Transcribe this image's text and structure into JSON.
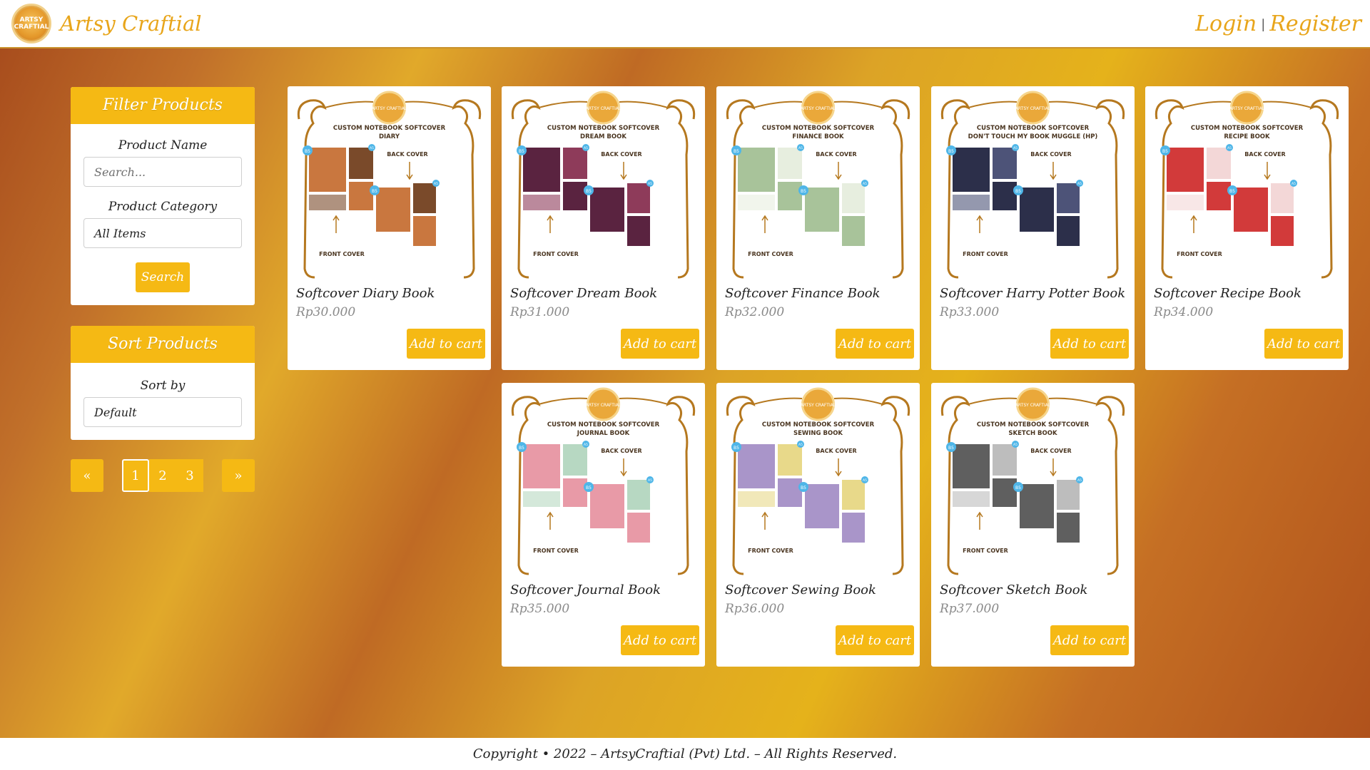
{
  "header": {
    "brand_name": "Artsy Craftial",
    "logo_text": "ARTSY CRAFTIAL",
    "login": "Login",
    "separator": "|",
    "register": "Register"
  },
  "filter": {
    "title": "Filter Products",
    "product_name_label": "Product Name",
    "search_placeholder": "Search...",
    "category_label": "Product Category",
    "category_value": "All Items",
    "search_button": "Search"
  },
  "sort": {
    "title": "Sort Products",
    "sort_by_label": "Sort by",
    "sort_value": "Default"
  },
  "pagination": {
    "prev": "«",
    "pages": [
      "1",
      "2",
      "3"
    ],
    "active_page": "1",
    "next": "»"
  },
  "cover_labels": {
    "back_cover": "BACK COVER",
    "front_cover": "FRONT COVER",
    "b5": "B5",
    "a5": "A5"
  },
  "products": [
    {
      "name": "Softcover Diary Book",
      "price": "Rp30.000",
      "cover_title": "CUSTOM NOTEBOOK SOFTCOVER",
      "cover_subtitle": "DIARY",
      "theme": "#c9773f",
      "theme2": "#7a4a2a"
    },
    {
      "name": "Softcover Dream Book",
      "price": "Rp31.000",
      "cover_title": "CUSTOM NOTEBOOK SOFTCOVER",
      "cover_subtitle": "DREAM BOOK",
      "theme": "#5a2340",
      "theme2": "#8e3b5a"
    },
    {
      "name": "Softcover Finance Book",
      "price": "Rp32.000",
      "cover_title": "CUSTOM NOTEBOOK SOFTCOVER",
      "cover_subtitle": "FINANCE BOOK",
      "theme": "#a8c39a",
      "theme2": "#e7eedf"
    },
    {
      "name": "Softcover Harry Potter Book",
      "price": "Rp33.000",
      "cover_title": "CUSTOM NOTEBOOK SOFTCOVER",
      "cover_subtitle": "DON'T TOUCH MY BOOK MUGGLE (HP)",
      "theme": "#2c2f4a",
      "theme2": "#4d5378"
    },
    {
      "name": "Softcover Recipe Book",
      "price": "Rp34.000",
      "cover_title": "CUSTOM NOTEBOOK SOFTCOVER",
      "cover_subtitle": "RECIPE BOOK",
      "theme": "#d23a3a",
      "theme2": "#f3d7d7"
    },
    {
      "name": "Softcover Journal Book",
      "price": "Rp35.000",
      "cover_title": "CUSTOM NOTEBOOK SOFTCOVER",
      "cover_subtitle": "JOURNAL BOOK",
      "theme": "#e89aa7",
      "theme2": "#b7d8c2"
    },
    {
      "name": "Softcover Sewing Book",
      "price": "Rp36.000",
      "cover_title": "CUSTOM NOTEBOOK SOFTCOVER",
      "cover_subtitle": "SEWING BOOK",
      "theme": "#a995c9",
      "theme2": "#e8d98a"
    },
    {
      "name": "Softcover Sketch Book",
      "price": "Rp37.000",
      "cover_title": "CUSTOM NOTEBOOK SOFTCOVER",
      "cover_subtitle": "SKETCH BOOK",
      "theme": "#5f5f5f",
      "theme2": "#bdbdbd"
    }
  ],
  "add_to_cart": "Add to cart",
  "footer": "Copyright • 2022 – ArtsyCraftial (Pvt) Ltd. – All Rights Reserved.",
  "colors": {
    "accent": "#f5b914",
    "brand_text": "#e8a51a",
    "price": "#8a8a8a"
  }
}
